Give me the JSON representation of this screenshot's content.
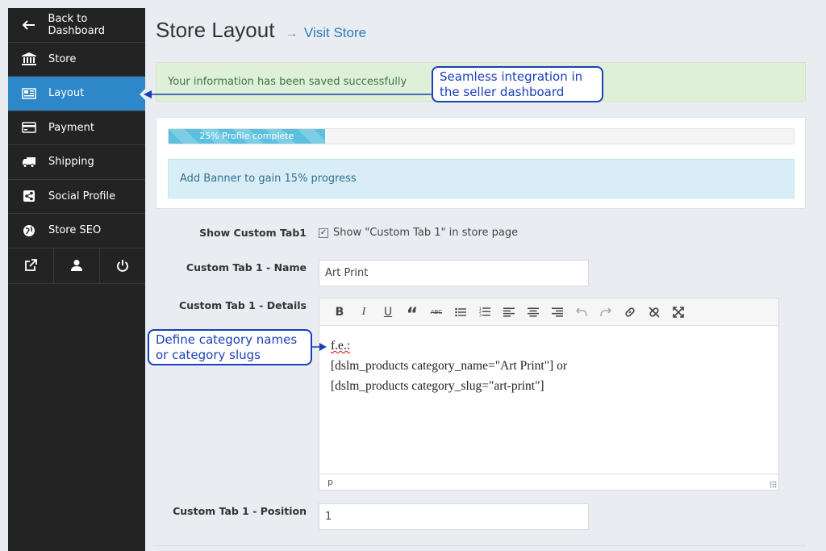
{
  "sidebar": {
    "items": [
      {
        "label": "Back to Dashboard",
        "icon": "arrow-left-icon"
      },
      {
        "label": "Store",
        "icon": "bank-icon"
      },
      {
        "label": "Layout",
        "icon": "newspaper-icon",
        "active": true
      },
      {
        "label": "Payment",
        "icon": "credit-card-icon"
      },
      {
        "label": "Shipping",
        "icon": "truck-icon"
      },
      {
        "label": "Social Profile",
        "icon": "share-icon"
      },
      {
        "label": "Store SEO",
        "icon": "globe-icon"
      }
    ],
    "bottom_icons": [
      "external-link-icon",
      "user-icon",
      "power-icon"
    ]
  },
  "header": {
    "title": "Store Layout",
    "arrow": "→",
    "visit_link": "Visit Store"
  },
  "alerts": {
    "success": "Your information has been saved successfully",
    "info": "Add Banner to gain 15% progress"
  },
  "progress": {
    "label": "25% Profile complete",
    "percent": 25
  },
  "form": {
    "show_tab_label": "Show Custom Tab1",
    "show_tab_checkbox_label": "Show \"Custom Tab 1\" in store page",
    "show_tab_checked": true,
    "name_label": "Custom Tab 1 - Name",
    "name_value": "Art Print",
    "details_label": "Custom Tab 1 - Details",
    "details_lines": [
      "f.e.:",
      "[dslm_products category_name=\"Art Print\"] or",
      "[dslm_products category_slug=\"art-print\"]"
    ],
    "editor_status": "p",
    "position_label": "Custom Tab 1 - Position",
    "position_value": "1"
  },
  "callouts": {
    "dashboard": "Seamless integration in the seller dashboard",
    "dashboard_line1": "Seamless integration in",
    "dashboard_line2": "the seller dashboard",
    "category_line1": "Define category names",
    "category_line2": "or category slugs"
  },
  "colors": {
    "sidebar_bg": "#232323",
    "active": "#2d87c8",
    "callout": "#1a3fb8",
    "success_bg": "#dff0d8",
    "info_bg": "#d9edf7",
    "progress": "#5bc0de"
  }
}
